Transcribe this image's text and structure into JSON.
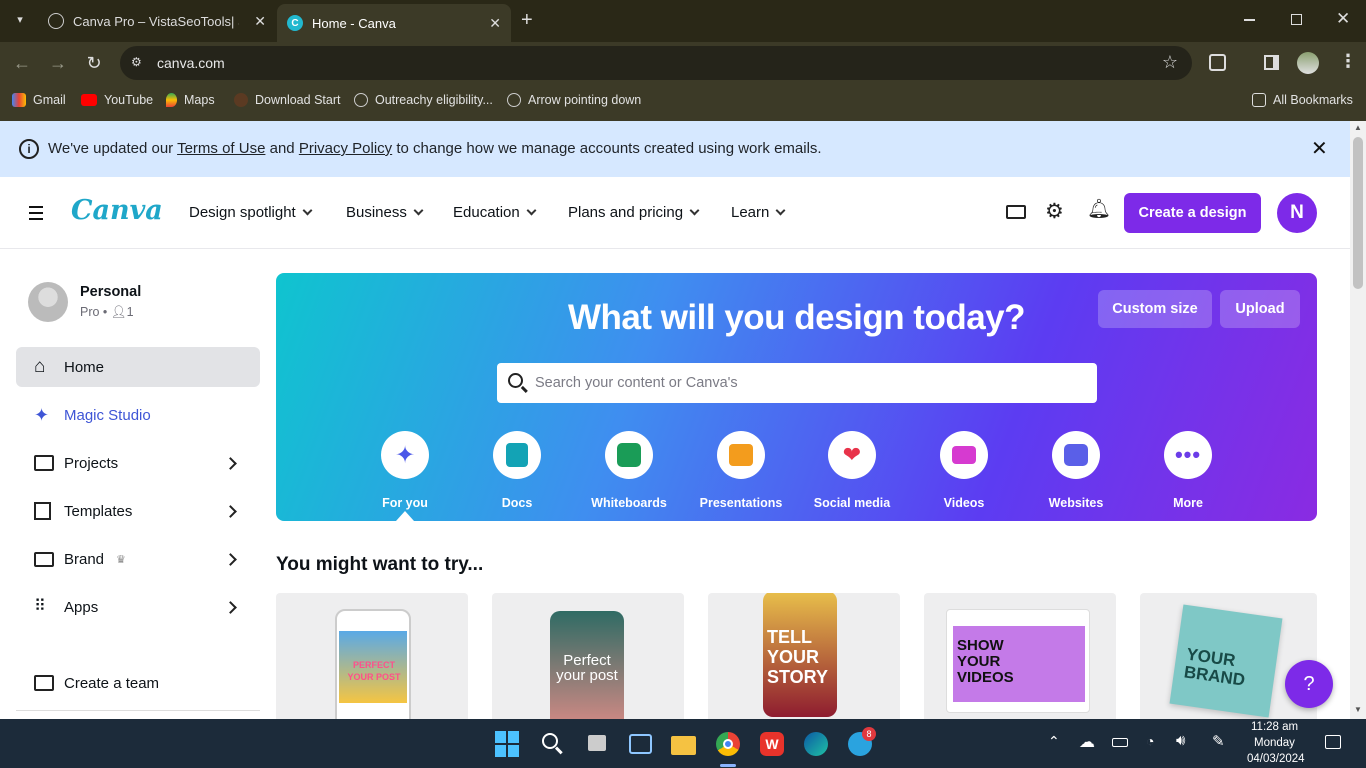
{
  "browser": {
    "tabs": [
      {
        "title": "Canva Pro – VistaSeoTools| SEO",
        "active": false
      },
      {
        "title": "Home - Canva",
        "active": true
      }
    ],
    "url": "canva.com",
    "bookmarks": [
      "Gmail",
      "YouTube",
      "Maps",
      "Download Start",
      "Outreachy eligibility...",
      "Arrow pointing down"
    ],
    "all_bookmarks": "All Bookmarks"
  },
  "notice": {
    "prefix": "We've updated our ",
    "terms": "Terms of Use",
    "and": " and ",
    "privacy": "Privacy Policy",
    "suffix": " to change how we manage accounts created using work emails."
  },
  "header": {
    "logo": "Canva",
    "nav": [
      "Design spotlight",
      "Business",
      "Education",
      "Plans and pricing",
      "Learn"
    ],
    "create_label": "Create a design",
    "avatar_initial": "N"
  },
  "sidebar": {
    "account_name": "Personal",
    "account_plan": "Pro",
    "account_members": "1",
    "items": [
      "Home",
      "Magic Studio",
      "Projects",
      "Templates",
      "Brand",
      "Apps"
    ],
    "create_team": "Create a team"
  },
  "hero": {
    "title": "What will you design today?",
    "custom_size": "Custom size",
    "upload": "Upload",
    "search_placeholder": "Search your content or Canva's",
    "categories": [
      "For you",
      "Docs",
      "Whiteboards",
      "Presentations",
      "Social media",
      "Videos",
      "Websites",
      "More"
    ]
  },
  "suggestions": {
    "title": "You might want to try...",
    "cards": [
      "PERFECT YOUR POST",
      "Perfect your post",
      "TELL YOUR STORY",
      "SHOW YOUR VIDEOS",
      "YOUR BRAND"
    ]
  },
  "help": "?",
  "taskbar": {
    "time": "11:28 am",
    "day": "Monday",
    "date": "04/03/2024",
    "telegram_badge": "8"
  },
  "colors": {
    "brand_purple": "#7d2ae8",
    "notice_bg": "#d6e8ff",
    "taskbar_bg": "#1c2b3a"
  }
}
